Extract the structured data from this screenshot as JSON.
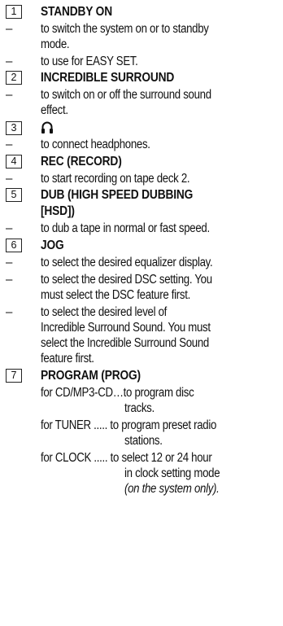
{
  "items": [
    {
      "number": "1",
      "title": "STANDBY ON",
      "bullets": [
        [
          "to switch the system on or to standby",
          "mode."
        ],
        [
          "to use for EASY SET."
        ]
      ]
    },
    {
      "number": "2",
      "title": "INCREDIBLE SURROUND",
      "bullets": [
        [
          "to switch on or off the surround sound",
          "effect."
        ]
      ]
    },
    {
      "number": "3",
      "title": "",
      "icon": "headphones-icon",
      "bullets": [
        [
          "to connect headphones."
        ]
      ]
    },
    {
      "number": "4",
      "title": "REC (RECORD)",
      "bullets": [
        [
          "to start recording on tape deck 2."
        ]
      ]
    },
    {
      "number": "5",
      "title_lines": [
        "DUB (HIGH SPEED DUBBING",
        "[HSD])"
      ],
      "bullets": [
        [
          "to dub a tape in normal or fast speed."
        ]
      ]
    },
    {
      "number": "6",
      "title": "JOG",
      "bullets": [
        [
          "to select the desired equalizer display."
        ],
        [
          "to select the desired DSC setting. You",
          "must select the DSC feature first."
        ],
        [
          "to select the desired level of",
          "Incredible Surround Sound. You must",
          "select the Incredible Surround Sound",
          "feature first."
        ]
      ]
    },
    {
      "number": "7",
      "title": "PROGRAM (PROG)",
      "modes": [
        {
          "label": "for CD/MP3-CD…to program disc",
          "lines": [
            "tracks."
          ]
        },
        {
          "label": "for TUNER ..... to program preset radio",
          "lines": [
            "stations."
          ]
        },
        {
          "label": "for CLOCK ..... to select 12 or 24 hour",
          "lines": [
            "in clock setting mode"
          ],
          "note": "(on the system only)."
        }
      ]
    }
  ],
  "dash": "–"
}
